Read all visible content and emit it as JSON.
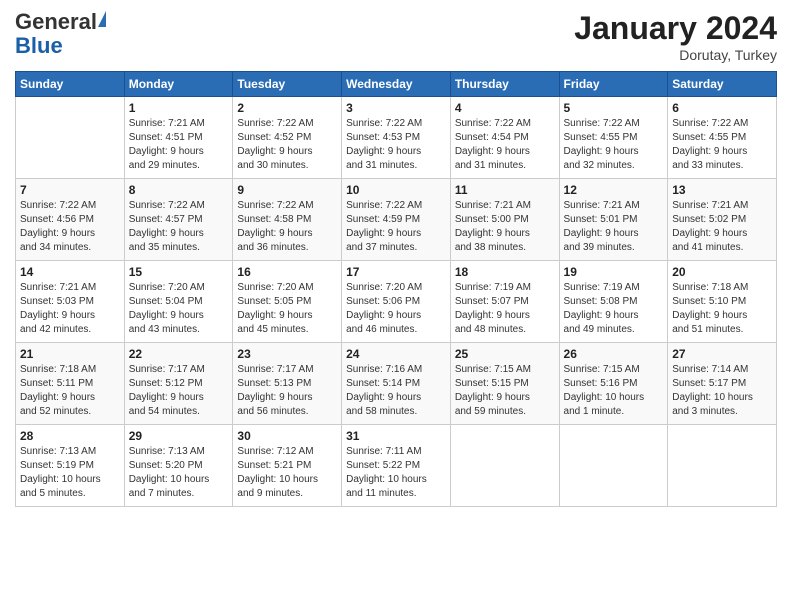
{
  "header": {
    "logo_general": "General",
    "logo_blue": "Blue",
    "month_year": "January 2024",
    "location": "Dorutay, Turkey"
  },
  "days_of_week": [
    "Sunday",
    "Monday",
    "Tuesday",
    "Wednesday",
    "Thursday",
    "Friday",
    "Saturday"
  ],
  "weeks": [
    [
      {
        "day": "",
        "info": ""
      },
      {
        "day": "1",
        "info": "Sunrise: 7:21 AM\nSunset: 4:51 PM\nDaylight: 9 hours\nand 29 minutes."
      },
      {
        "day": "2",
        "info": "Sunrise: 7:22 AM\nSunset: 4:52 PM\nDaylight: 9 hours\nand 30 minutes."
      },
      {
        "day": "3",
        "info": "Sunrise: 7:22 AM\nSunset: 4:53 PM\nDaylight: 9 hours\nand 31 minutes."
      },
      {
        "day": "4",
        "info": "Sunrise: 7:22 AM\nSunset: 4:54 PM\nDaylight: 9 hours\nand 31 minutes."
      },
      {
        "day": "5",
        "info": "Sunrise: 7:22 AM\nSunset: 4:55 PM\nDaylight: 9 hours\nand 32 minutes."
      },
      {
        "day": "6",
        "info": "Sunrise: 7:22 AM\nSunset: 4:55 PM\nDaylight: 9 hours\nand 33 minutes."
      }
    ],
    [
      {
        "day": "7",
        "info": "Sunrise: 7:22 AM\nSunset: 4:56 PM\nDaylight: 9 hours\nand 34 minutes."
      },
      {
        "day": "8",
        "info": "Sunrise: 7:22 AM\nSunset: 4:57 PM\nDaylight: 9 hours\nand 35 minutes."
      },
      {
        "day": "9",
        "info": "Sunrise: 7:22 AM\nSunset: 4:58 PM\nDaylight: 9 hours\nand 36 minutes."
      },
      {
        "day": "10",
        "info": "Sunrise: 7:22 AM\nSunset: 4:59 PM\nDaylight: 9 hours\nand 37 minutes."
      },
      {
        "day": "11",
        "info": "Sunrise: 7:21 AM\nSunset: 5:00 PM\nDaylight: 9 hours\nand 38 minutes."
      },
      {
        "day": "12",
        "info": "Sunrise: 7:21 AM\nSunset: 5:01 PM\nDaylight: 9 hours\nand 39 minutes."
      },
      {
        "day": "13",
        "info": "Sunrise: 7:21 AM\nSunset: 5:02 PM\nDaylight: 9 hours\nand 41 minutes."
      }
    ],
    [
      {
        "day": "14",
        "info": "Sunrise: 7:21 AM\nSunset: 5:03 PM\nDaylight: 9 hours\nand 42 minutes."
      },
      {
        "day": "15",
        "info": "Sunrise: 7:20 AM\nSunset: 5:04 PM\nDaylight: 9 hours\nand 43 minutes."
      },
      {
        "day": "16",
        "info": "Sunrise: 7:20 AM\nSunset: 5:05 PM\nDaylight: 9 hours\nand 45 minutes."
      },
      {
        "day": "17",
        "info": "Sunrise: 7:20 AM\nSunset: 5:06 PM\nDaylight: 9 hours\nand 46 minutes."
      },
      {
        "day": "18",
        "info": "Sunrise: 7:19 AM\nSunset: 5:07 PM\nDaylight: 9 hours\nand 48 minutes."
      },
      {
        "day": "19",
        "info": "Sunrise: 7:19 AM\nSunset: 5:08 PM\nDaylight: 9 hours\nand 49 minutes."
      },
      {
        "day": "20",
        "info": "Sunrise: 7:18 AM\nSunset: 5:10 PM\nDaylight: 9 hours\nand 51 minutes."
      }
    ],
    [
      {
        "day": "21",
        "info": "Sunrise: 7:18 AM\nSunset: 5:11 PM\nDaylight: 9 hours\nand 52 minutes."
      },
      {
        "day": "22",
        "info": "Sunrise: 7:17 AM\nSunset: 5:12 PM\nDaylight: 9 hours\nand 54 minutes."
      },
      {
        "day": "23",
        "info": "Sunrise: 7:17 AM\nSunset: 5:13 PM\nDaylight: 9 hours\nand 56 minutes."
      },
      {
        "day": "24",
        "info": "Sunrise: 7:16 AM\nSunset: 5:14 PM\nDaylight: 9 hours\nand 58 minutes."
      },
      {
        "day": "25",
        "info": "Sunrise: 7:15 AM\nSunset: 5:15 PM\nDaylight: 9 hours\nand 59 minutes."
      },
      {
        "day": "26",
        "info": "Sunrise: 7:15 AM\nSunset: 5:16 PM\nDaylight: 10 hours\nand 1 minute."
      },
      {
        "day": "27",
        "info": "Sunrise: 7:14 AM\nSunset: 5:17 PM\nDaylight: 10 hours\nand 3 minutes."
      }
    ],
    [
      {
        "day": "28",
        "info": "Sunrise: 7:13 AM\nSunset: 5:19 PM\nDaylight: 10 hours\nand 5 minutes."
      },
      {
        "day": "29",
        "info": "Sunrise: 7:13 AM\nSunset: 5:20 PM\nDaylight: 10 hours\nand 7 minutes."
      },
      {
        "day": "30",
        "info": "Sunrise: 7:12 AM\nSunset: 5:21 PM\nDaylight: 10 hours\nand 9 minutes."
      },
      {
        "day": "31",
        "info": "Sunrise: 7:11 AM\nSunset: 5:22 PM\nDaylight: 10 hours\nand 11 minutes."
      },
      {
        "day": "",
        "info": ""
      },
      {
        "day": "",
        "info": ""
      },
      {
        "day": "",
        "info": ""
      }
    ]
  ]
}
